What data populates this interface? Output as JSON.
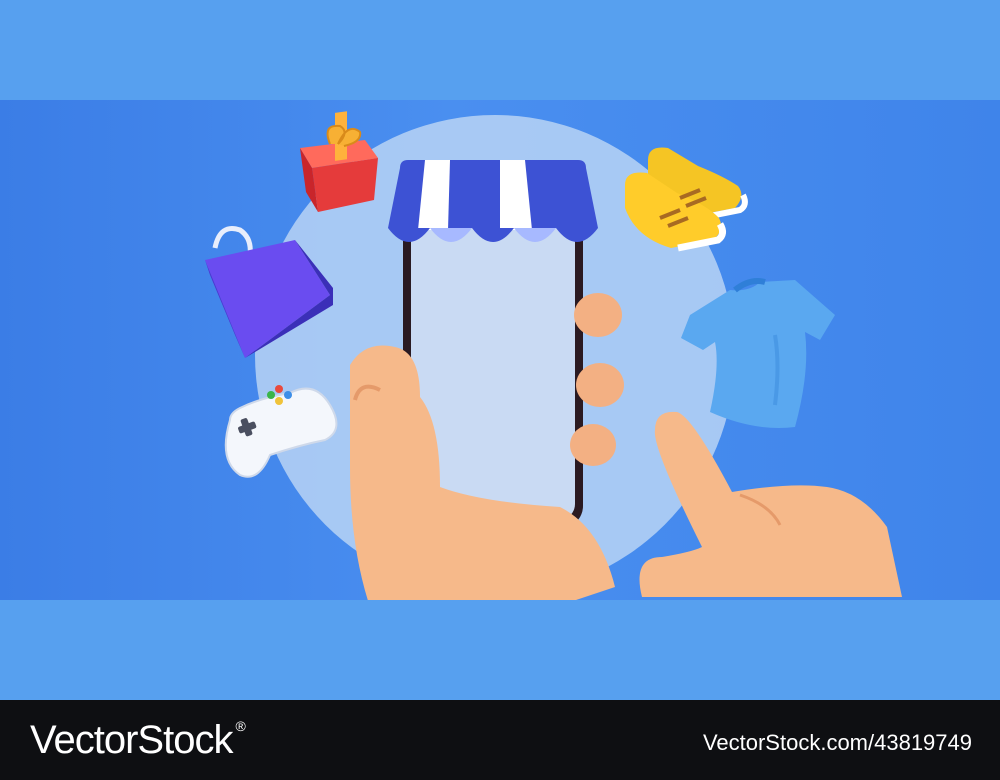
{
  "footer": {
    "brand_text": "VectorStock",
    "trademark": "®",
    "image_id": "VectorStock.com/43819749"
  },
  "illustration": {
    "icons": [
      "gift-box-icon",
      "shopping-bag-icon",
      "game-controller-icon",
      "sneakers-icon",
      "t-shirt-icon",
      "smartphone-store-icon",
      "holding-hand-icon",
      "pointing-hand-icon"
    ],
    "colors": {
      "background": "#57a0ef",
      "scene": "#4a8ff0",
      "circle": "#b8d4f5",
      "awning_blue": "#3d52d4",
      "phone_screen": "#c9daf3",
      "skin": "#f6b98a",
      "footer": "#0e0f12"
    }
  }
}
